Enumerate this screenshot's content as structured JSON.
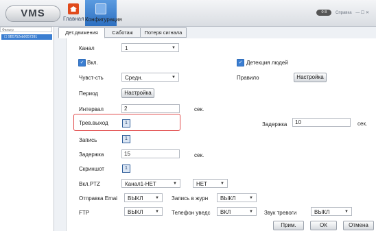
{
  "header": {
    "logo": "VMS",
    "nav": [
      {
        "label": "Главная"
      },
      {
        "label": "Конфигурация"
      }
    ],
    "toggle_label": "0 8",
    "help_label": "Справка",
    "window_controls": "— ☐ ✕"
  },
  "sidebar": {
    "filter_placeholder": "Фильтр",
    "device": "9B5752eb0057391"
  },
  "tabs": [
    "Дет.движения",
    "Саботаж",
    "Потеря сигнала"
  ],
  "form": {
    "channel_label": "Канал",
    "channel_value": "1",
    "enable_label": "Вкл.",
    "people_detect_label": "Детекция людей",
    "sensitivity_label": "Чувст-сть",
    "sensitivity_value": "Средн.",
    "rule_label": "Правило",
    "rule_button": "Настройка",
    "period_label": "Период",
    "period_button": "Настройка",
    "interval_label": "Интервал",
    "interval_value": "2",
    "interval_unit": "сек.",
    "alarm_out_label": "Трев.выход",
    "alarm_out_value": "1",
    "delay_right_label": "Задержка",
    "delay_right_value": "10",
    "delay_right_unit": "сек.",
    "record_label": "Запись",
    "record_value": "1",
    "delay_label": "Задержка",
    "delay_value": "15",
    "delay_unit": "сек.",
    "snapshot_label": "Скриншот",
    "snapshot_value": "1",
    "ptz_label": "Вкл.PTZ",
    "ptz_channel_value": "Канал1-НЕТ",
    "ptz_value": "НЕТ",
    "email_label": "Отправка Emai",
    "email_value": "ВЫКЛ",
    "log_label": "Запись в журн",
    "log_value": "ВЫКЛ",
    "ftp_label": "FTP",
    "ftp_value": "ВЫКЛ",
    "phone_label": "Телефон уведс",
    "phone_value": "ВКЛ",
    "sound_label": "Звук тревоги",
    "sound_value": "ВЫКЛ",
    "apply_button": "Прим.",
    "ok_button": "ОК",
    "cancel_button": "Отмена"
  },
  "colors": {
    "accent": "#3b7ed1",
    "highlight": "#e14b4b"
  }
}
